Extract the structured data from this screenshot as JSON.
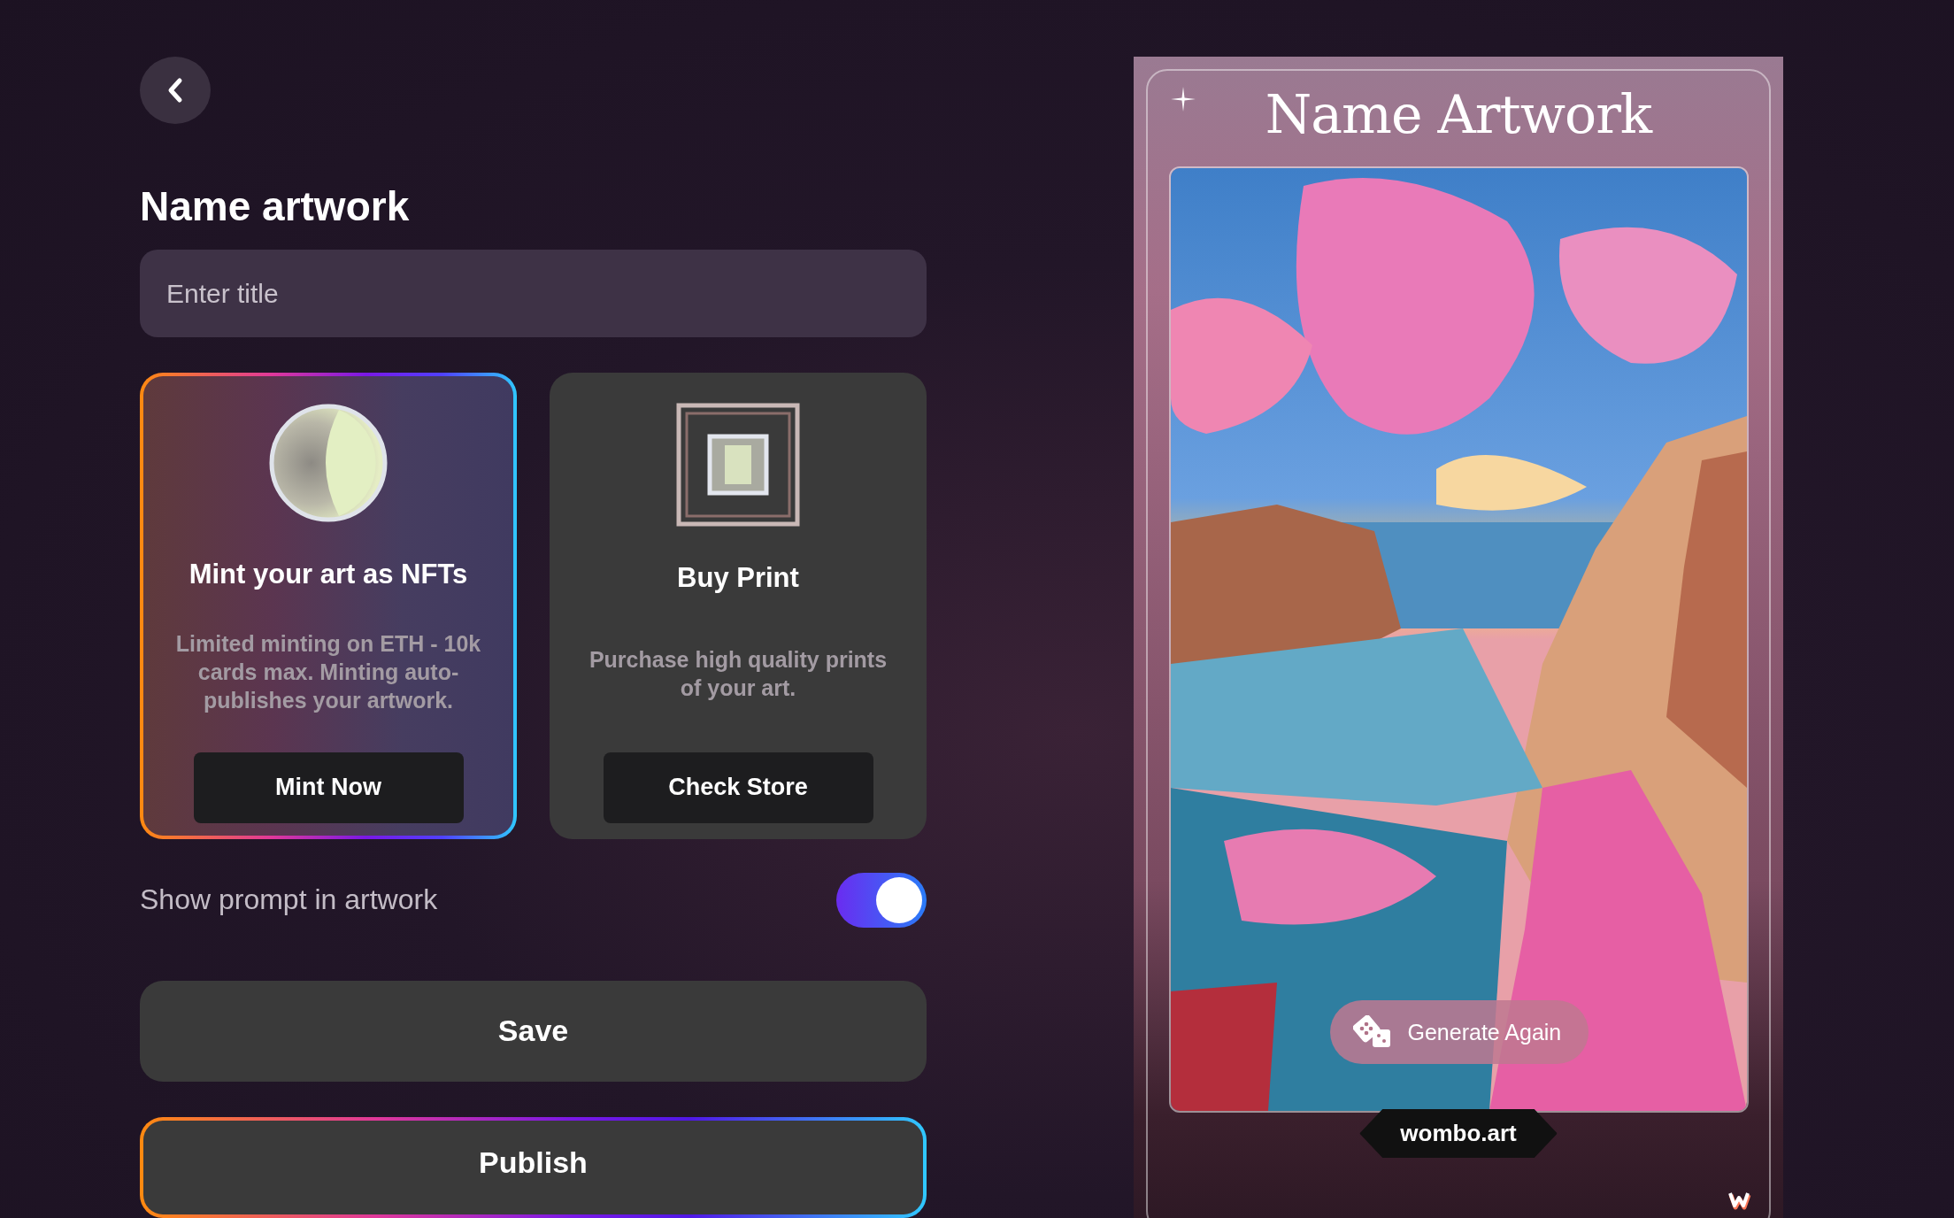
{
  "heading": "Name artwork",
  "title_field": {
    "placeholder": "Enter title"
  },
  "options": [
    {
      "kind": "nft",
      "title": "Mint your art as NFTs",
      "description": "Limited minting on ETH - 10k cards max. Minting auto-publishes your artwork.",
      "button": "Mint Now",
      "selected": true
    },
    {
      "kind": "print",
      "title": "Buy Print",
      "description": "Purchase high quality prints of your art.",
      "button": "Check Store",
      "selected": false
    }
  ],
  "prompt_toggle": {
    "label": "Show prompt in artwork",
    "on": true
  },
  "buttons": [
    {
      "kind": "plain",
      "label": "Save"
    },
    {
      "kind": "gradient",
      "label": "Publish"
    }
  ],
  "preview": {
    "title": "Name Artwork",
    "generate_button": "Generate Again",
    "watermark": "wombo.art"
  }
}
